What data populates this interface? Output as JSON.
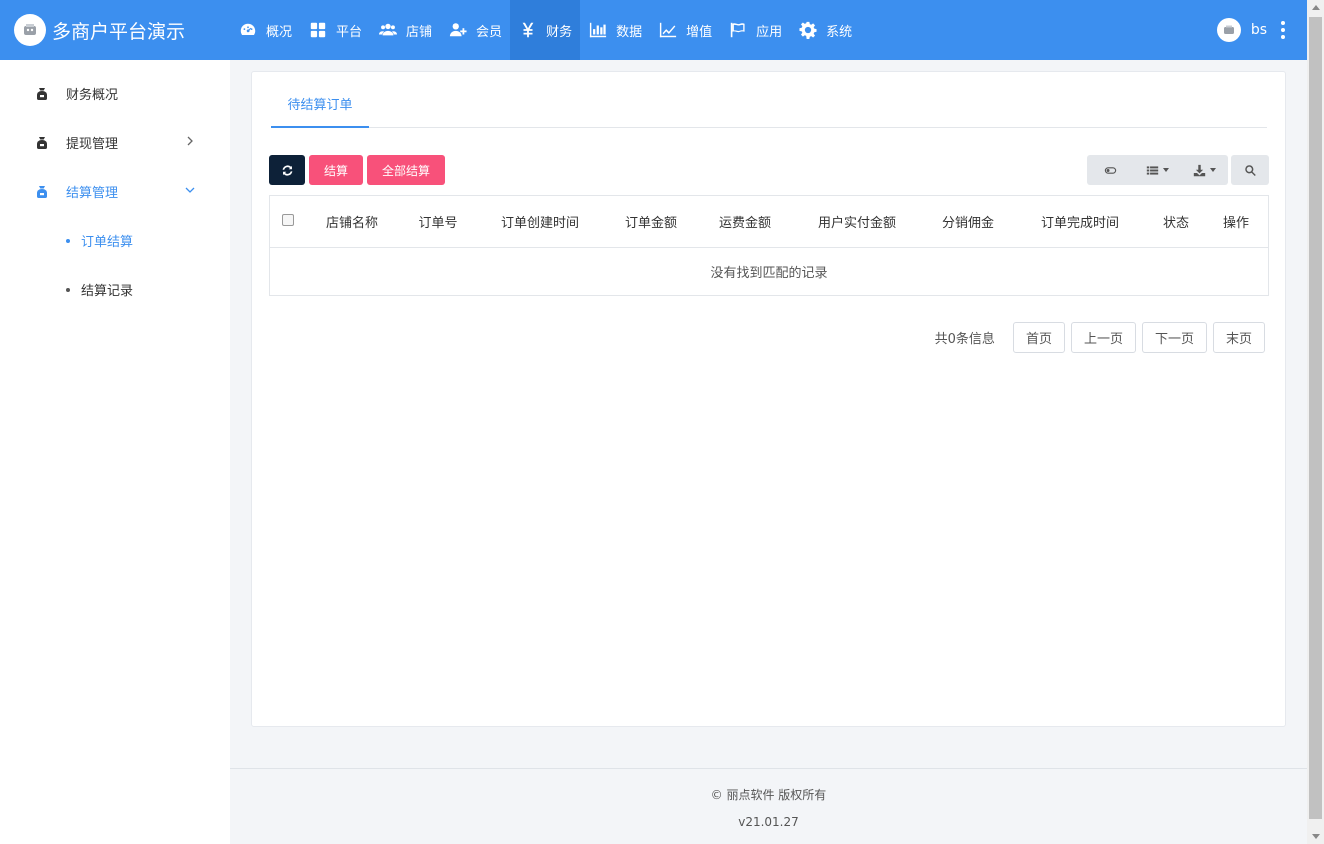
{
  "brand": {
    "title": "多商户平台演示"
  },
  "nav": {
    "items": [
      {
        "label": "概况",
        "icon": "dashboard-icon"
      },
      {
        "label": "平台",
        "icon": "grid-icon"
      },
      {
        "label": "店铺",
        "icon": "users-icon"
      },
      {
        "label": "会员",
        "icon": "user-plus-icon"
      },
      {
        "label": "财务",
        "icon": "yen-icon"
      },
      {
        "label": "数据",
        "icon": "bar-chart-icon"
      },
      {
        "label": "增值",
        "icon": "line-chart-icon"
      },
      {
        "label": "应用",
        "icon": "flag-icon"
      },
      {
        "label": "系统",
        "icon": "gear-icon"
      }
    ],
    "active": "财务"
  },
  "user": {
    "name": "bs"
  },
  "sidebar": {
    "items": [
      {
        "label": "财务概况"
      },
      {
        "label": "提现管理"
      },
      {
        "label": "结算管理"
      }
    ],
    "sub_items": [
      {
        "label": "订单结算"
      },
      {
        "label": "结算记录"
      }
    ]
  },
  "tabs": {
    "active": "待结算订单"
  },
  "toolbar": {
    "settle_label": "结算",
    "settle_all_label": "全部结算"
  },
  "table": {
    "columns": [
      "店铺名称",
      "订单号",
      "订单创建时间",
      "订单金额",
      "运费金额",
      "用户实付金额",
      "分销佣金",
      "订单完成时间",
      "状态",
      "操作"
    ],
    "empty_text": "没有找到匹配的记录"
  },
  "pager": {
    "info": "共0条信息",
    "first": "首页",
    "prev": "上一页",
    "next": "下一页",
    "last": "末页"
  },
  "footer": {
    "copyright": "© 丽点软件 版权所有",
    "version": "v21.01.27"
  },
  "colors": {
    "primary": "#3c8fef",
    "accent_pink": "#f8517a",
    "dark_button": "#0d2138"
  }
}
